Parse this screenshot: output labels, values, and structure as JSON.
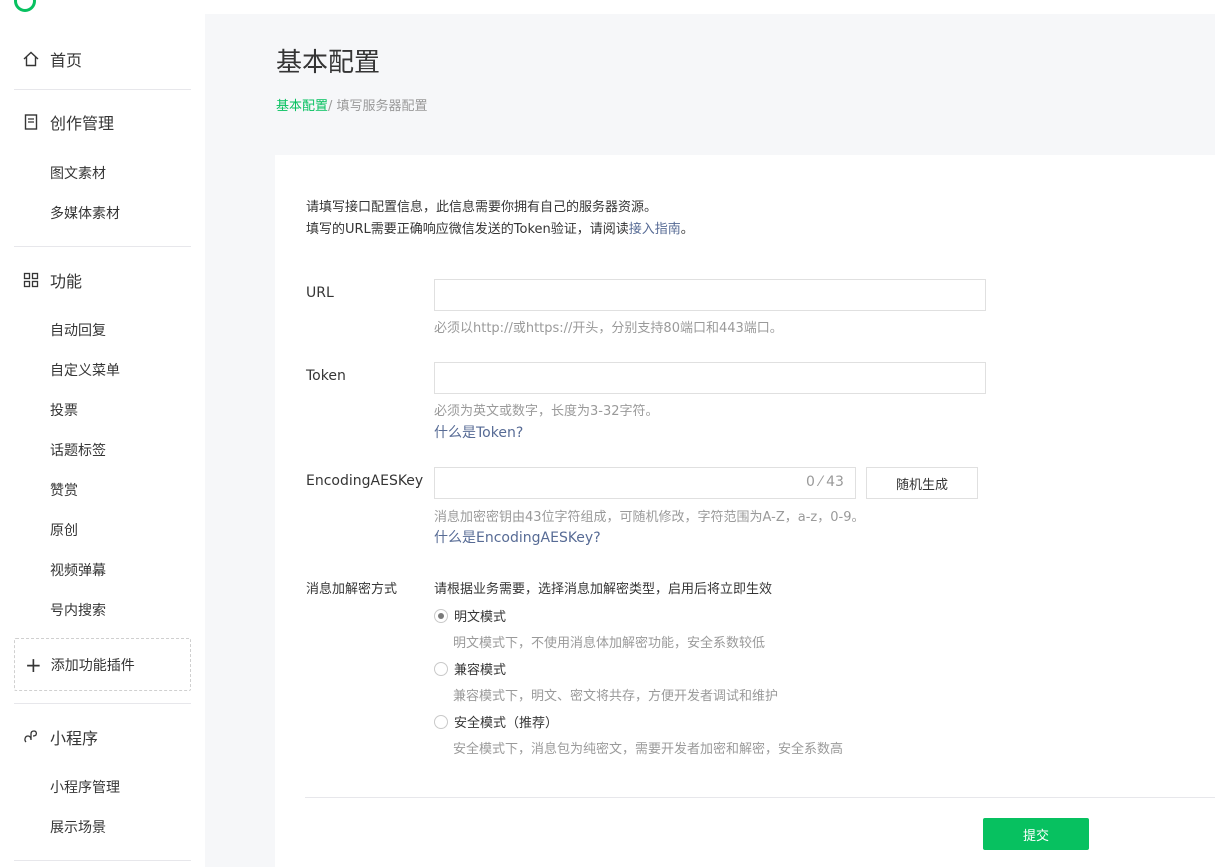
{
  "sidebar": {
    "home": "首页",
    "creation": "创作管理",
    "creation_items": [
      "图文素材",
      "多媒体素材"
    ],
    "features": "功能",
    "feature_items": [
      "自动回复",
      "自定义菜单",
      "投票",
      "话题标签",
      "赞赏",
      "原创",
      "视频弹幕",
      "号内搜索"
    ],
    "add_plugin": "添加功能插件",
    "miniprogram": "小程序",
    "miniprogram_items": [
      "小程序管理",
      "展示场景"
    ]
  },
  "page": {
    "title": "基本配置",
    "breadcrumb_link": "基本配置",
    "breadcrumb_current": "/ 填写服务器配置"
  },
  "intro": {
    "line1": "请填写接口配置信息，此信息需要你拥有自己的服务器资源。",
    "line2_prefix": "填写的URL需要正确响应微信发送的Token验证，请阅读",
    "line2_link": "接入指南",
    "line2_suffix": "。"
  },
  "form": {
    "url_label": "URL",
    "url_value": "",
    "url_hint": "必须以http://或https://开头，分别支持80端口和443端口。",
    "token_label": "Token",
    "token_value": "",
    "token_hint": "必须为英文或数字，长度为3-32字符。",
    "token_help": "什么是Token?",
    "aes_label": "EncodingAESKey",
    "aes_value": "",
    "aes_counter": "0 ⁄ 43",
    "aes_random_button": "随机生成",
    "aes_hint": "消息加密密钥由43位字符组成，可随机修改，字符范围为A-Z，a-z，0-9。",
    "aes_help": "什么是EncodingAESKey?",
    "mode_label": "消息加解密方式",
    "mode_desc": "请根据业务需要，选择消息加解密类型，启用后将立即生效",
    "modes": [
      {
        "label": "明文模式",
        "desc": "明文模式下，不使用消息体加解密功能，安全系数较低",
        "checked": true
      },
      {
        "label": "兼容模式",
        "desc": "兼容模式下，明文、密文将共存，方便开发者调试和维护",
        "checked": false
      },
      {
        "label": "安全模式（推荐）",
        "desc": "安全模式下，消息包为纯密文，需要开发者加密和解密，安全系数高",
        "checked": false
      }
    ],
    "submit": "提交"
  },
  "colors": {
    "accent": "#07c160",
    "link": "#576b95",
    "hint": "#9a9a9a"
  }
}
